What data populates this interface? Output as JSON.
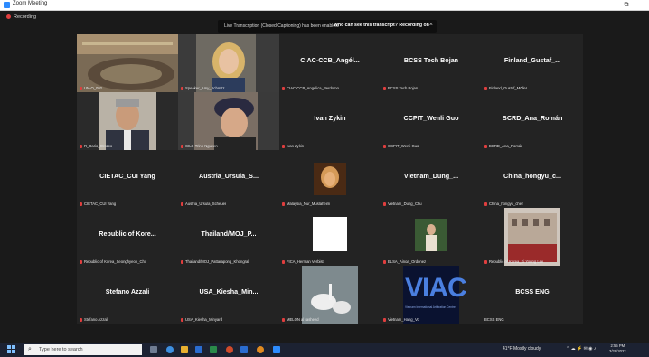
{
  "window": {
    "title": "Zoom Meeting",
    "minimize": "–",
    "restore": "⧉"
  },
  "meeting": {
    "recording_label": "Recording",
    "banner": {
      "message": "Live Transcription (Closed Captioning) has been enabled.",
      "link": "Who can see this transcript? Recording on",
      "close": "×"
    },
    "tiles": [
      {
        "big": "",
        "cap": "UN-O_092",
        "photo": "room"
      },
      {
        "big": "",
        "cap": "Speaker_Amy_Schmitz",
        "photo": "woman-blonde"
      },
      {
        "big": "CIAC-CCB_Angél...",
        "cap": "CIAC-CCB_Angélica_Perdomo"
      },
      {
        "big": "BCSS Tech Bojan",
        "cap": "BCSS Tech Bojan"
      },
      {
        "big": "Finland_Gustaf_...",
        "cap": "Finland_Gustaf_Möller"
      },
      {
        "big": "",
        "cap": "R_Dario_Orozco",
        "photo": "man"
      },
      {
        "big": "",
        "cap": "CILS-Trinh Nguyen",
        "photo": "woman-hat"
      },
      {
        "big": "Ivan Zykin",
        "cap": "Ivan Zykin"
      },
      {
        "big": "CCPIT_Wenli Guo",
        "cap": "CCPIT_Wenli Guo"
      },
      {
        "big": "BCRD_Ana_Román",
        "cap": "BCRD_Ana_Román"
      },
      {
        "big": "CIETAC_CUI Yang",
        "cap": "CIETAC_CUI Yang"
      },
      {
        "big": "Austria_Ursula_S...",
        "cap": "Austria_Ursula_Scheuer"
      },
      {
        "big": "",
        "cap": "Malaysia_Nur_Muslaheim",
        "photo": "small-portrait"
      },
      {
        "big": "Vietnam_Dung_...",
        "cap": "Vietnam_Dung_Chu"
      },
      {
        "big": "China_hongyu_c...",
        "cap": "China_hongyu_chen"
      },
      {
        "big": "Republic of Kore...",
        "cap": "Republic of Korea_Seonghyeon_Cho"
      },
      {
        "big": "Thailand/MOJ_P...",
        "cap": "Thailand/MOJ_Pattarapong_Khongrak"
      },
      {
        "big": "",
        "cap": "FICA_Herman Verbist",
        "photo": "white-square"
      },
      {
        "big": "",
        "cap": "ELSA_Ainoa_Ordonez",
        "photo": "woman-standing"
      },
      {
        "big": "",
        "cap": "Republic of Korea_Ki Young Lee",
        "photo": "building"
      },
      {
        "big": "Stefano Azzali",
        "cap": "Stefano Azzali"
      },
      {
        "big": "USA_Kiesha_Min...",
        "cap": "USA_Kiesha_Minyard"
      },
      {
        "big": "",
        "cap": "MELON al rasheed",
        "photo": "swans"
      },
      {
        "big": "",
        "cap": "Vietnam_Hang_Vo",
        "photo": "viac"
      },
      {
        "big": "BCSS ENG",
        "cap": "BCSS ENG"
      }
    ],
    "viac_text": "VIAC",
    "viac_sub": "Vietnam International Arbitration Centre"
  },
  "taskbar": {
    "search_placeholder": "Type here to search",
    "weather": "41°F  Mostly cloudy",
    "time": "2:55 PM",
    "date": "3/29/2022"
  },
  "colors": {
    "bg": "#1a1a1a",
    "tile": "#232323",
    "accent": "#2d8cff",
    "mute": "#e03e3e"
  }
}
